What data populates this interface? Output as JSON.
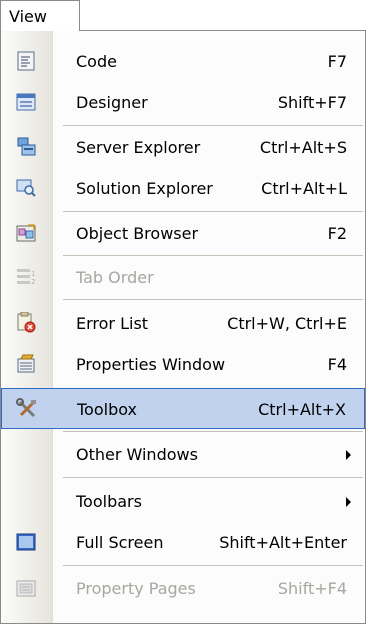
{
  "menu": {
    "title": "View",
    "items": [
      {
        "label": "Code",
        "shortcut": "F7",
        "icon": "code-icon"
      },
      {
        "label": "Designer",
        "shortcut": "Shift+F7",
        "icon": "designer-icon"
      },
      {
        "label": "Server Explorer",
        "shortcut": "Ctrl+Alt+S",
        "icon": "server-explorer-icon"
      },
      {
        "label": "Solution Explorer",
        "shortcut": "Ctrl+Alt+L",
        "icon": "solution-explorer-icon"
      },
      {
        "label": "Object Browser",
        "shortcut": "F2",
        "icon": "object-browser-icon"
      },
      {
        "label": "Tab Order",
        "shortcut": "",
        "icon": "tab-order-icon",
        "disabled": true
      },
      {
        "label": "Error List",
        "shortcut": "Ctrl+W, Ctrl+E",
        "icon": "error-list-icon"
      },
      {
        "label": "Properties Window",
        "shortcut": "F4",
        "icon": "properties-window-icon"
      },
      {
        "label": "Toolbox",
        "shortcut": "Ctrl+Alt+X",
        "icon": "toolbox-icon",
        "highlighted": true
      },
      {
        "label": "Other Windows",
        "shortcut": "",
        "submenu": true
      },
      {
        "label": "Toolbars",
        "shortcut": "",
        "submenu": true
      },
      {
        "label": "Full Screen",
        "shortcut": "Shift+Alt+Enter",
        "icon": "full-screen-icon"
      },
      {
        "label": "Property Pages",
        "shortcut": "Shift+F4",
        "icon": "property-pages-icon",
        "disabled": true
      }
    ]
  },
  "colors": {
    "highlight_fill": "#c1d2ee",
    "highlight_border": "#316ac5",
    "disabled_text": "#a7a6a0"
  }
}
